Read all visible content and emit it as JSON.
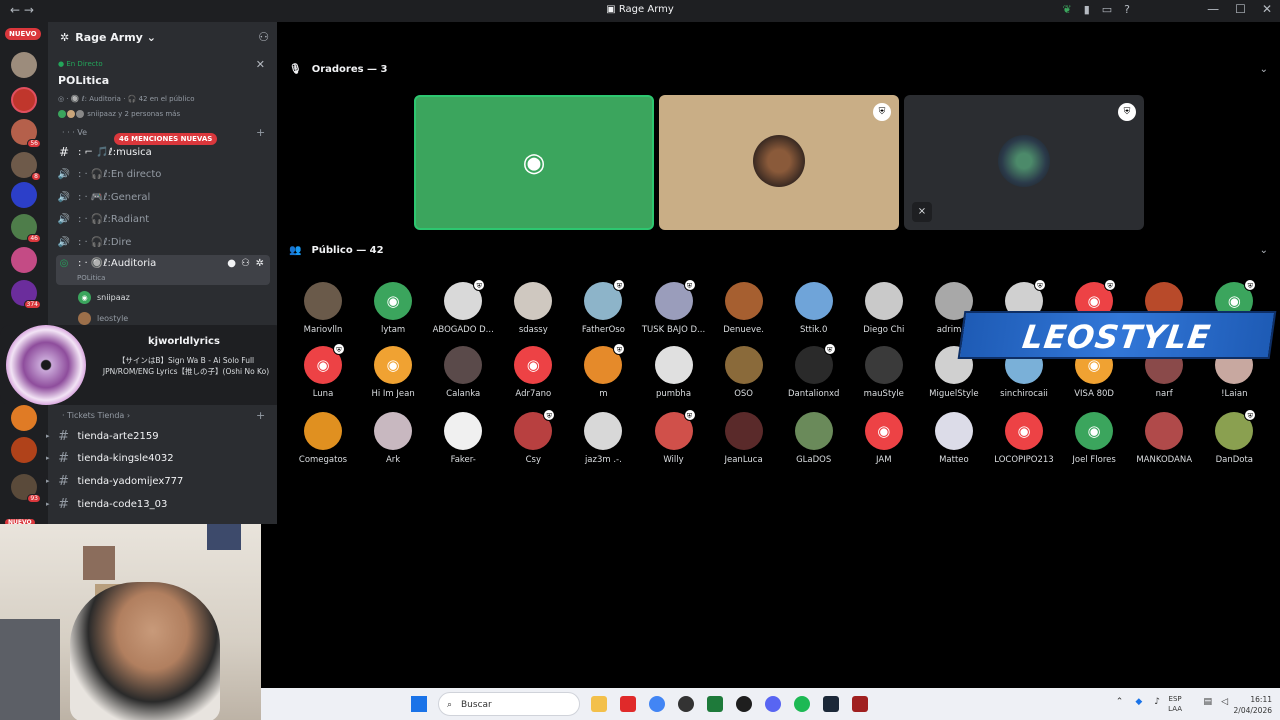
{
  "window": {
    "title": "Rage Army"
  },
  "rail": {
    "badge_new_top": "NUEVO",
    "badge_new_bottom": "NUEVO",
    "badges": [
      "56",
      "8",
      "46",
      "374",
      "93"
    ]
  },
  "server": {
    "name": "Rage Army"
  },
  "live": {
    "status": "En Directo",
    "topic": "POLitica",
    "meta_channel": "Auditoria",
    "meta_audience": "42 en el público",
    "meta_people": "sniipaaz y 2 personas más"
  },
  "channels": {
    "mentions_badge": "46 MENCIONES NUEVAS",
    "category_ve": "Ve",
    "musica": "musica",
    "en_directo": "En directo",
    "general": "General",
    "radiant": "Radiant",
    "dire": "Dire",
    "auditoria": "Auditoria",
    "auditoria_sub": "POLitica",
    "member1": "sniipaaz",
    "member2": "leostyle",
    "tickets_category": "Tickets Tienda",
    "tienda1": "tienda-arte2159",
    "tienda2": "tienda-kingsle4032",
    "tienda3": "tienda-yadomijex777",
    "tienda4": "tienda-code13_03"
  },
  "music": {
    "user": "kjworldlyrics",
    "song": "【サインはB】Sign Wa B - Ai Solo Full JPN/ROM/ENG Lyrics【推しの子】(Oshi No Ko)"
  },
  "stage": {
    "speakers_header": "Oradores — 3",
    "audience_header": "Público — 42",
    "overlay_text": "LEOSTYLE"
  },
  "audience_row1": [
    "Mariovlln",
    "lytam",
    "ABOGADO D...",
    "sdassy",
    "FatherOso",
    "TUSK BAJO D...",
    "Denueve.",
    "Sttik.0",
    "Diego Chi",
    "adrimas",
    "",
    "",
    "",
    ""
  ],
  "audience_row2": [
    "Luna",
    "Hi Im Jean",
    "Calanka",
    "Adr7ano",
    "m",
    "pumbha",
    "OSO",
    "Dantalionxd",
    "mauStyle",
    "MiguelStyle",
    "sinchirocaii",
    "VISA 80D",
    "narf",
    "!Laian"
  ],
  "audience_row3": [
    "Comegatos",
    "Ark",
    "Faker-",
    "Csy",
    "jaz3m .-.",
    "Willy",
    "JeanLuca",
    "GLaDOS",
    "JAM",
    "Matteo",
    "LOCOPIPO213",
    "Joel Flores",
    "MANKODANA",
    "DanDota"
  ],
  "taskbar": {
    "search_placeholder": "Buscar",
    "lang_top": "ESP",
    "lang_bottom": "LAA",
    "time": "16:11",
    "date": "2/04/2026"
  },
  "colors": {
    "discord_green": "#3ba55d",
    "discord_red": "#ed4245",
    "discord_orange": "#f0a232",
    "accent": "#5865f2"
  }
}
